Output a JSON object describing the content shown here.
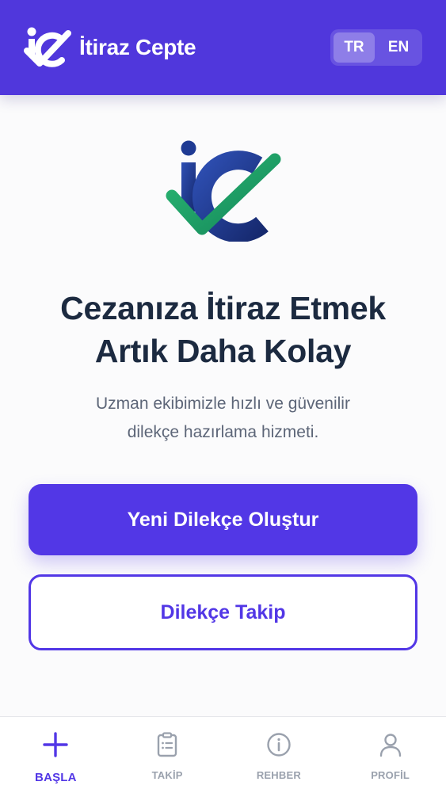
{
  "header": {
    "app_name": "İtiraz Cepte",
    "languages": [
      {
        "code": "TR",
        "active": true
      },
      {
        "code": "EN",
        "active": false
      }
    ]
  },
  "hero": {
    "title_line1": "Cezanıza İtiraz Etmek",
    "title_line2": "Artık Daha Kolay",
    "subtitle_line1": "Uzman ekibimizle hızlı ve güvenilir",
    "subtitle_line2": "dilekçe hazırlama hizmeti."
  },
  "actions": {
    "primary_label": "Yeni Dilekçe Oluştur",
    "secondary_label": "Dilekçe Takip"
  },
  "bottom_nav": [
    {
      "label": "BAŞLA",
      "icon": "plus-icon",
      "active": true
    },
    {
      "label": "TAKİP",
      "icon": "clipboard-icon",
      "active": false
    },
    {
      "label": "REHBER",
      "icon": "info-icon",
      "active": false
    },
    {
      "label": "PROFİL",
      "icon": "user-icon",
      "active": false
    }
  ],
  "colors": {
    "brand": "#5037dc",
    "accent": "#5237e6",
    "logo_blue": "#1f3a93",
    "logo_green": "#22a06b",
    "title": "#1c2a40",
    "muted": "#9aa1ad"
  }
}
